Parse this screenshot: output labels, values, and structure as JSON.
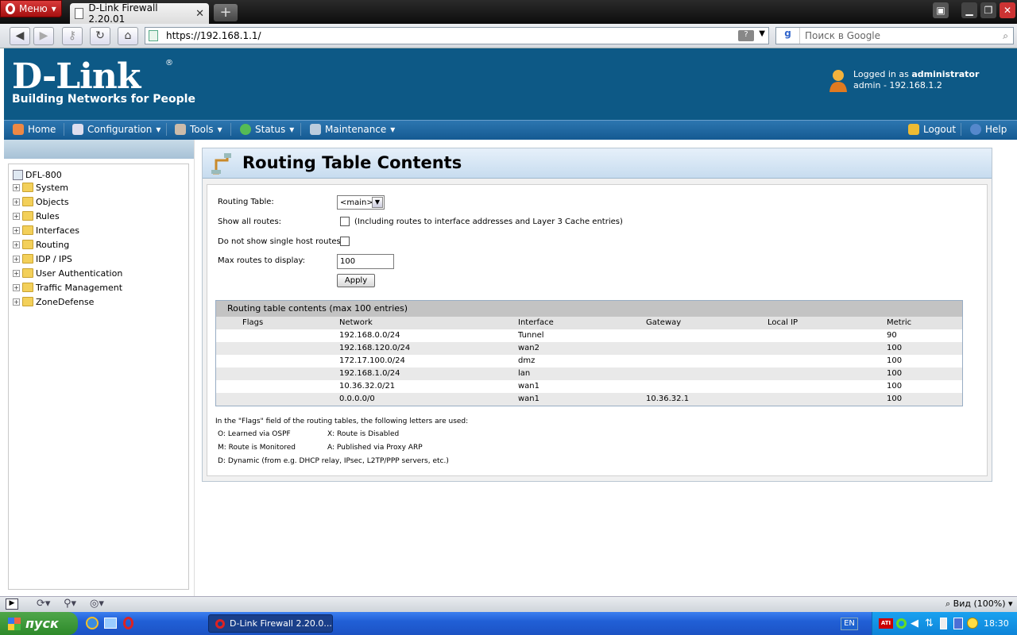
{
  "browser": {
    "menu_label": "Меню",
    "tab_title": "D-Link Firewall 2.20.01",
    "tab_close": "✕",
    "new_tab": "+",
    "url": "https://192.168.1.1/",
    "search_placeholder": "Поиск в Google",
    "zoom": "Вид (100%)"
  },
  "header": {
    "logo": "D-Link",
    "registered": "®",
    "tagline": "Building Networks for People",
    "logged_in_prefix": "Logged in as ",
    "user": "administrator",
    "session": "admin - 192.168.1.2"
  },
  "nav": {
    "home": "Home",
    "configuration": "Configuration",
    "tools": "Tools",
    "status": "Status",
    "maintenance": "Maintenance",
    "logout": "Logout",
    "help": "Help"
  },
  "tree": {
    "root": "DFL-800",
    "items": [
      "System",
      "Objects",
      "Rules",
      "Interfaces",
      "Routing",
      "IDP / IPS",
      "User Authentication",
      "Traffic Management",
      "ZoneDefense"
    ]
  },
  "page": {
    "title": "Routing Table Contents",
    "routing_table_label": "Routing Table:",
    "routing_table_value": "<main>",
    "show_all_label": "Show all routes:",
    "show_all_note": "(Including routes to interface addresses and Layer 3 Cache entries)",
    "no_single_label": "Do not show single host routes:",
    "max_routes_label": "Max routes to display:",
    "max_routes_value": "100",
    "apply": "Apply"
  },
  "table": {
    "caption": "Routing table contents (max 100 entries)",
    "columns": [
      "Flags",
      "Network",
      "Interface",
      "Gateway",
      "Local IP",
      "Metric"
    ],
    "rows": [
      [
        "",
        "192.168.0.0/24",
        "Tunnel",
        "",
        "",
        "90"
      ],
      [
        "",
        "192.168.120.0/24",
        "wan2",
        "",
        "",
        "100"
      ],
      [
        "",
        "172.17.100.0/24",
        "dmz",
        "",
        "",
        "100"
      ],
      [
        "",
        "192.168.1.0/24",
        "lan",
        "",
        "",
        "100"
      ],
      [
        "",
        "10.36.32.0/21",
        "wan1",
        "",
        "",
        "100"
      ],
      [
        "",
        "0.0.0.0/0",
        "wan1",
        "10.36.32.1",
        "",
        "100"
      ]
    ]
  },
  "legend": {
    "intro": "In the \"Flags\" field of the routing tables, the following letters are used:",
    "o": "O: Learned via OSPF",
    "x": "X: Route is Disabled",
    "m": "M: Route is Monitored",
    "a": "A: Published via Proxy ARP",
    "d": "D: Dynamic (from e.g. DHCP relay, IPsec, L2TP/PPP servers, etc.)"
  },
  "taskbar": {
    "start": "пуск",
    "task": "D-Link Firewall 2.20.0...",
    "lang": "EN",
    "time": "18:30"
  }
}
